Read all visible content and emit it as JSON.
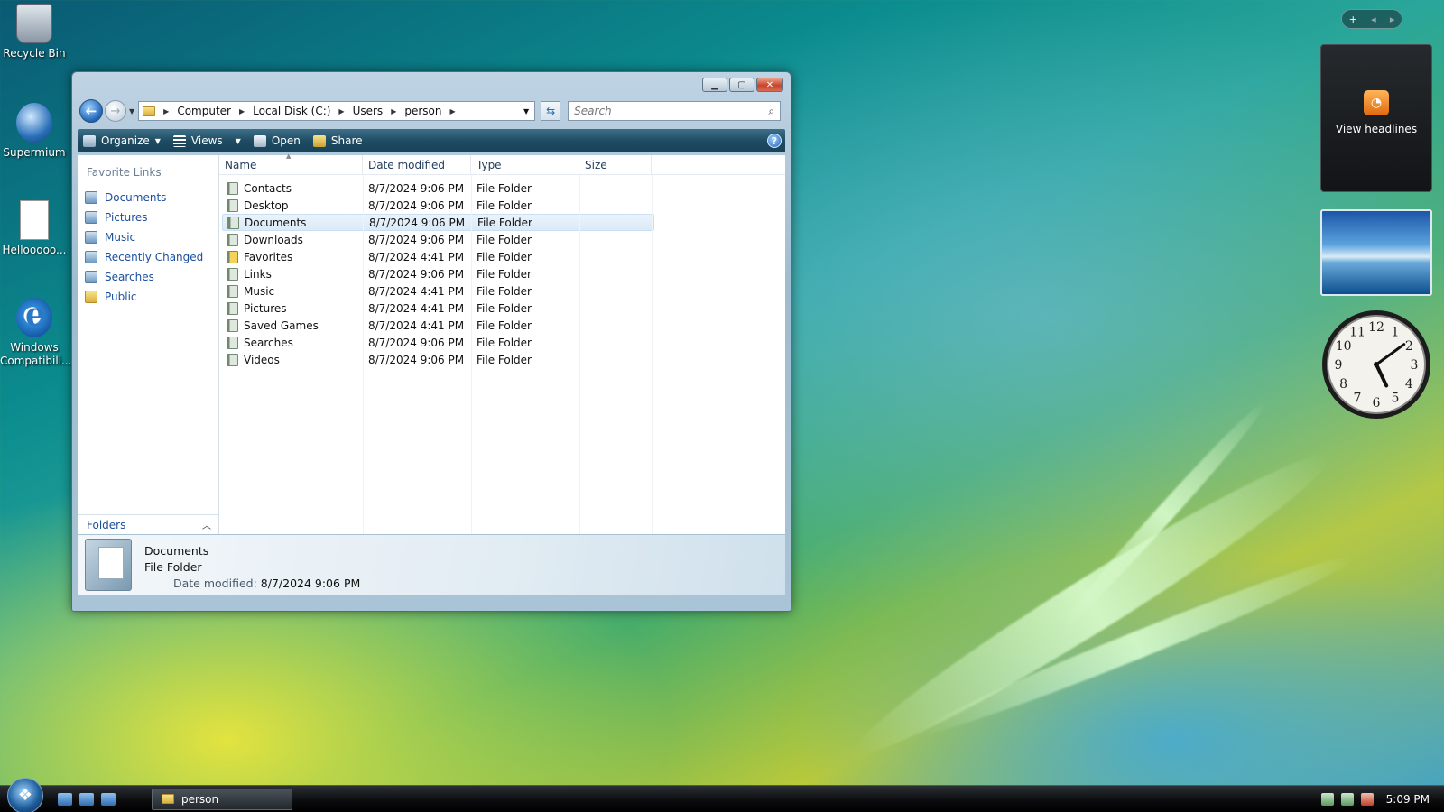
{
  "desktop": {
    "icons": [
      {
        "label": "Recycle Bin"
      },
      {
        "label": "Supermium"
      },
      {
        "label": "Hellooooo..."
      },
      {
        "label": "Windows Compatibili..."
      }
    ]
  },
  "window": {
    "breadcrumb": [
      "Computer",
      "Local Disk (C:)",
      "Users",
      "person"
    ],
    "search_placeholder": "Search",
    "toolbar": {
      "organize": "Organize",
      "views": "Views",
      "open": "Open",
      "share": "Share",
      "help": "?"
    },
    "nav_pane": {
      "title": "Favorite Links",
      "items": [
        "Documents",
        "Pictures",
        "Music",
        "Recently Changed",
        "Searches",
        "Public"
      ],
      "folders_label": "Folders"
    },
    "columns": [
      "Name",
      "Date modified",
      "Type",
      "Size"
    ],
    "rows": [
      {
        "name": "Contacts",
        "date": "8/7/2024 9:06 PM",
        "type": "File Folder"
      },
      {
        "name": "Desktop",
        "date": "8/7/2024 9:06 PM",
        "type": "File Folder"
      },
      {
        "name": "Documents",
        "date": "8/7/2024 9:06 PM",
        "type": "File Folder"
      },
      {
        "name": "Downloads",
        "date": "8/7/2024 9:06 PM",
        "type": "File Folder"
      },
      {
        "name": "Favorites",
        "date": "8/7/2024 4:41 PM",
        "type": "File Folder"
      },
      {
        "name": "Links",
        "date": "8/7/2024 9:06 PM",
        "type": "File Folder"
      },
      {
        "name": "Music",
        "date": "8/7/2024 4:41 PM",
        "type": "File Folder"
      },
      {
        "name": "Pictures",
        "date": "8/7/2024 4:41 PM",
        "type": "File Folder"
      },
      {
        "name": "Saved Games",
        "date": "8/7/2024 4:41 PM",
        "type": "File Folder"
      },
      {
        "name": "Searches",
        "date": "8/7/2024 9:06 PM",
        "type": "File Folder"
      },
      {
        "name": "Videos",
        "date": "8/7/2024 9:06 PM",
        "type": "File Folder"
      }
    ],
    "selected_row": "Documents",
    "details": {
      "name": "Documents",
      "type": "File Folder",
      "date_label": "Date modified:",
      "date_value": "8/7/2024 9:06 PM"
    }
  },
  "sidebar": {
    "feed_label": "View headlines",
    "clock_numbers": [
      "12",
      "1",
      "2",
      "3",
      "4",
      "5",
      "6",
      "7",
      "8",
      "9",
      "10",
      "11"
    ],
    "clock_time": "5:09"
  },
  "taskbar": {
    "task_label": "person",
    "clock": "5:09 PM"
  },
  "colors": {
    "toolbar": "#1f4c62",
    "link": "#1b4f9c",
    "selected_row": "#dbeaf8"
  }
}
